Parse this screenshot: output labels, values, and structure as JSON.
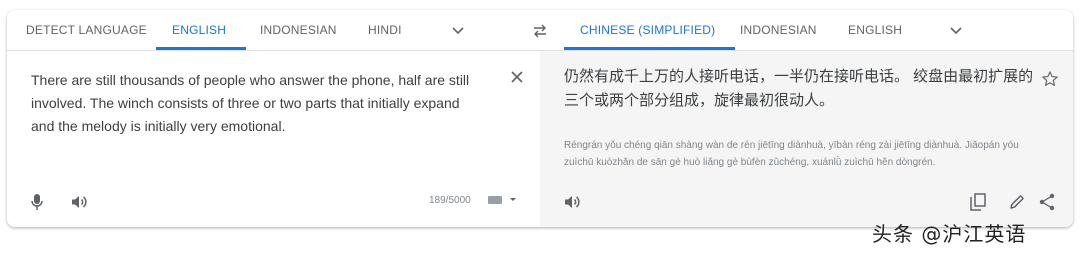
{
  "source_tabs": {
    "detect": "DETECT LANGUAGE",
    "english": "ENGLISH",
    "indonesian": "INDONESIAN",
    "hindi": "HINDI"
  },
  "target_tabs": {
    "chinese": "CHINESE (SIMPLIFIED)",
    "indonesian": "INDONESIAN",
    "english": "ENGLISH"
  },
  "source": {
    "text": "There are still thousands of people who answer the phone, half are still involved. The winch consists of three or two parts that initially expand and the melody is initially very emotional.",
    "char_count": "189/5000"
  },
  "target": {
    "text": "仍然有成千上万的人接听电话，一半仍在接听电话。 绞盘由最初扩展的三个或两个部分组成，旋律最初很动人。",
    "romanization": "Réngrán yǒu chéng qiān shàng wàn de rén jiētīng diànhuà, yībàn réng zài jiētīng diànhuà. Jiǎopán yóu zuìchū kuòzhǎn de sān gè huò liǎng gè bùfèn zǔchéng, xuánlǜ zuìchū hěn dòngrén."
  },
  "watermark": "头条 @沪江英语",
  "colors": {
    "accent": "#1a73e8",
    "pane_bg": "#f5f5f5",
    "text": "#3c4043",
    "muted": "#5f6368"
  },
  "icons": [
    "chevron-down-icon",
    "swap-icon",
    "close-icon",
    "star-icon",
    "mic-icon",
    "speaker-icon",
    "keyboard-icon",
    "copy-icon",
    "pencil-icon",
    "share-icon"
  ]
}
